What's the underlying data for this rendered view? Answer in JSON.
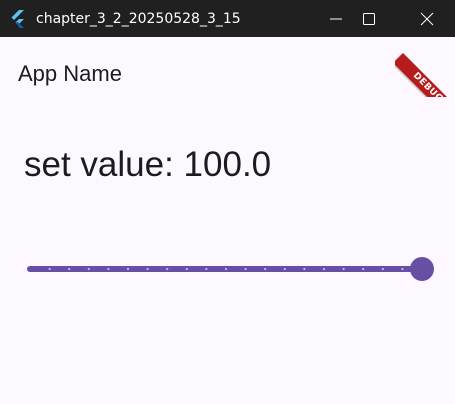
{
  "window": {
    "title": "chapter_3_2_20250528_3_15",
    "logo_icon": "flutter-logo-icon",
    "minimize_icon": "minimize-icon",
    "maximize_icon": "maximize-icon",
    "close_icon": "close-icon"
  },
  "app_bar": {
    "title": "App Name"
  },
  "main": {
    "value_prefix": "set value: ",
    "value": "100.0"
  },
  "slider": {
    "min": 0,
    "max": 100,
    "value": 100,
    "divisions": 20,
    "active_color": "#6750a4"
  },
  "debug_banner": {
    "label": "DEBUG",
    "color": "#b71c1c"
  },
  "colors": {
    "titlebar_bg": "#202020",
    "background": "#fdf7ff",
    "text": "#1d1b20"
  }
}
